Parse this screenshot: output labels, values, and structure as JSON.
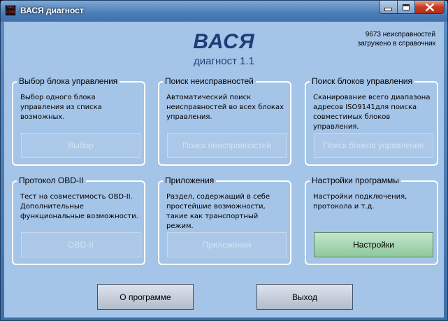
{
  "window": {
    "title": "ВАСЯ диагност",
    "icon": "app-icon"
  },
  "header": {
    "app_name": "ВАСЯ",
    "version": "диагност 1.1",
    "info_line1": "9673 неисправностей",
    "info_line2": "загружено в справочник"
  },
  "groups": [
    {
      "title": "Выбор блока управления",
      "description": "Выбор одного блока управления из списка возможных.",
      "button": "Выбор",
      "enabled": false
    },
    {
      "title": "Поиск неисправностей",
      "description": "Автоматический поиск неисправностей во всех блоках управления.",
      "button": "Поиск неисправностей",
      "enabled": false
    },
    {
      "title": "Поиск блоков управления",
      "description": "Сканирование всего диапазона адресов ISO9141для поиска совместимых блоков управления.",
      "button": "Поиск блоков управления",
      "enabled": false
    },
    {
      "title": "Протокол OBD-II",
      "description": "Тест на совместимость OBD-II. Дополнительные функциональные возможности.",
      "button": "OBD-II",
      "enabled": false
    },
    {
      "title": "Приложения",
      "description": "Раздел, содержащий в себе простейшие возможности, такие как транспортный режим.",
      "button": "Приложения",
      "enabled": false
    },
    {
      "title": "Настройки программы",
      "description": "Настройки подключения, протокола и т.д.",
      "button": "Настройки",
      "enabled": true
    }
  ],
  "footer": {
    "about_button": "О программе",
    "exit_button": "Выход"
  }
}
